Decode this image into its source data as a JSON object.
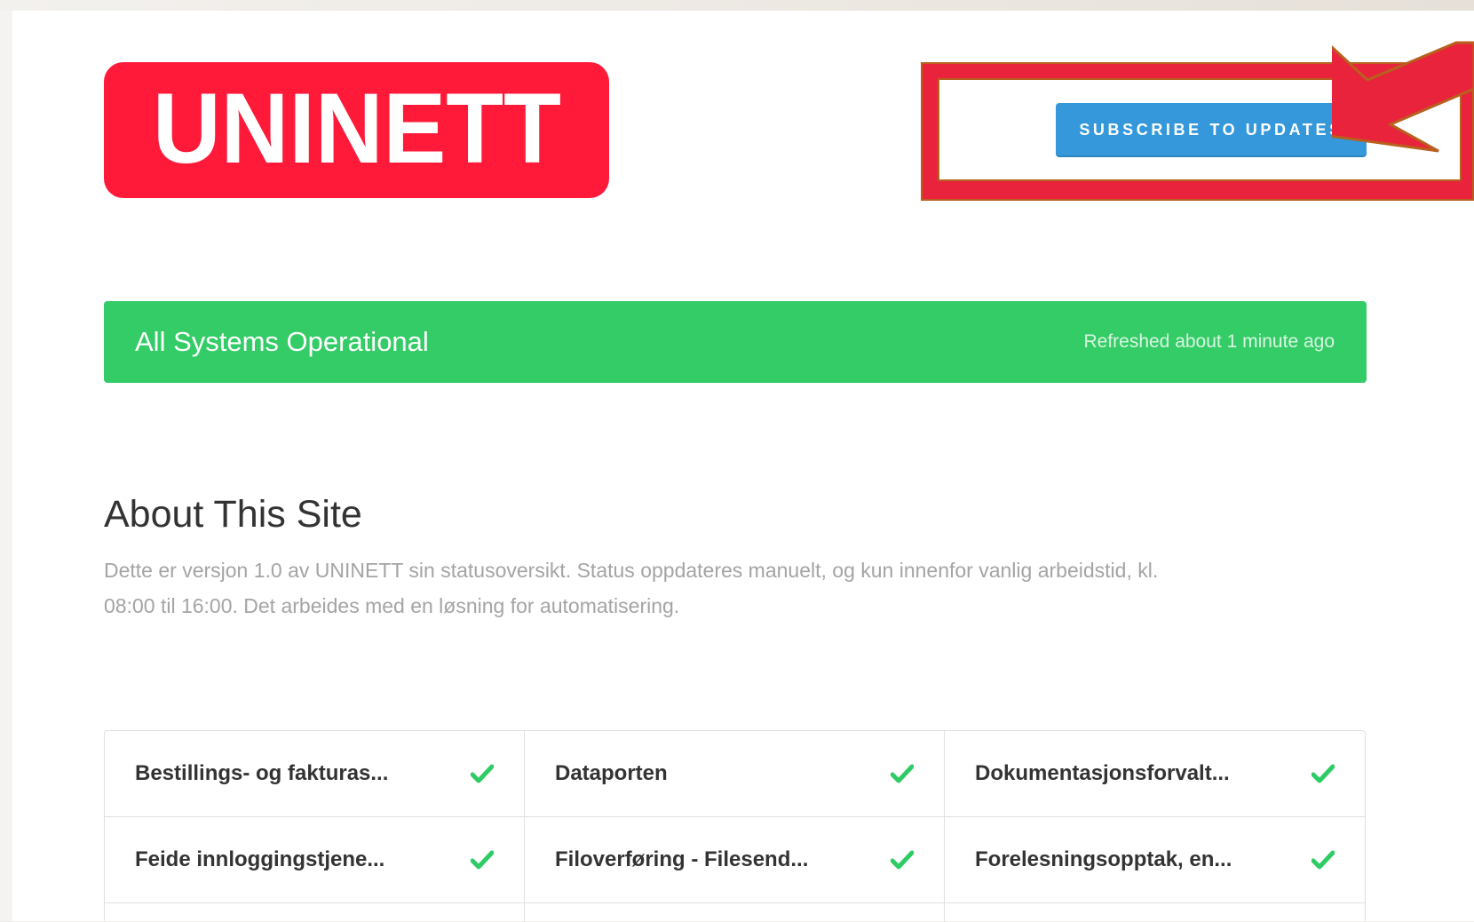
{
  "header": {
    "logo_text": "UNINETT",
    "subscribe_label": "SUBSCRIBE TO UPDATES"
  },
  "status": {
    "title": "All Systems Operational",
    "refreshed": "Refreshed about 1 minute ago"
  },
  "about": {
    "title": "About This Site",
    "line1": "Dette er versjon 1.0 av UNINETT sin statusoversikt. Status oppdateres manuelt, og kun innenfor vanlig arbeidstid, kl.",
    "line2": "08:00 til 16:00. Det arbeides med en løsning for automatisering."
  },
  "components": [
    {
      "name": "Bestillings- og fakturas...",
      "status_icon": "check-icon"
    },
    {
      "name": "Dataporten",
      "status_icon": "check-icon"
    },
    {
      "name": "Dokumentasjonsforvalt...",
      "status_icon": "check-icon"
    },
    {
      "name": "Feide innloggingstjene...",
      "status_icon": "check-icon"
    },
    {
      "name": "Filoverføring - Filesend...",
      "status_icon": "check-icon"
    },
    {
      "name": "Forelesningsopptak, en...",
      "status_icon": "check-icon"
    }
  ],
  "colors": {
    "brand_red": "#ff1a39",
    "button_blue": "#3498db",
    "status_green": "#33cc66",
    "check_green": "#2fcc66",
    "annotation_red": "#e8233b",
    "annotation_outline": "#b8601d"
  }
}
